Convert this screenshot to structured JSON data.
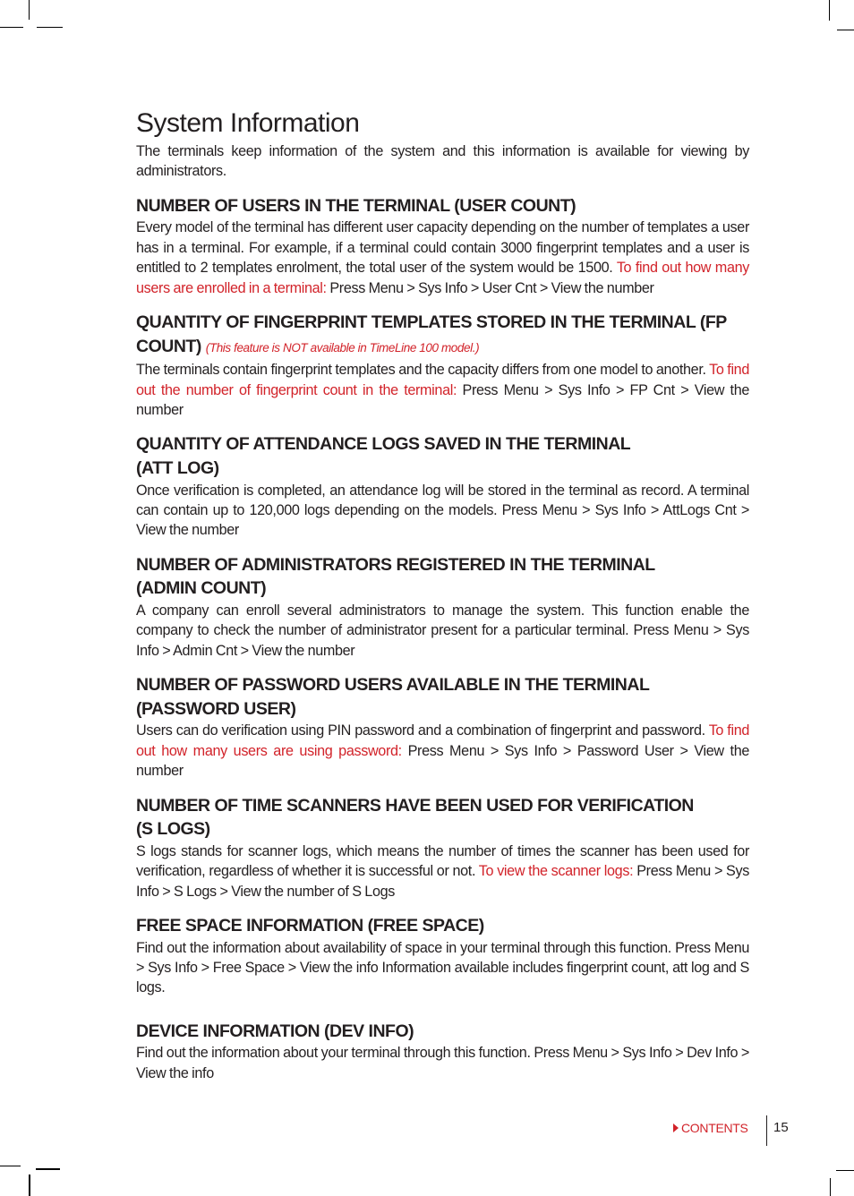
{
  "page": {
    "title": "System Information",
    "intro": "The terminals keep information of the system and this information is available for viewing by administrators."
  },
  "sections": [
    {
      "heading": "NUMBER OF USERS IN THE TERMINAL (USER COUNT)",
      "body_before": "Every model of the terminal has different user capacity depending on the number of templates a user has in a terminal. For example, if a terminal could contain 3000 fingerprint templates and a user is entitled to 2 templates enrolment, the total user of the system would be 1500. ",
      "highlight": "To find out how many users are enrolled in a terminal:",
      "body_after": " Press Menu > Sys Info > User Cnt > View the number"
    },
    {
      "heading": "QUANTITY OF FINGERPRINT TEMPLATES STORED IN THE TERMINAL (FP COUNT)",
      "note": "(This feature is NOT available in TimeLine 100 model.)",
      "body_before": "The terminals contain fingerprint templates and the capacity differs from one model to another. ",
      "highlight": "To find out the number of fingerprint count in the terminal:",
      "body_after": " Press Menu > Sys Info > FP Cnt > View the number"
    },
    {
      "heading_line1": "QUANTITY OF ATTENDANCE LOGS SAVED IN THE TERMINAL",
      "heading_line2": "(ATT LOG)",
      "body": "Once verification is completed, an attendance log will be stored in the terminal as record. A terminal can contain up to 120,000 logs depending on the models. Press Menu > Sys Info > AttLogs Cnt > View the number"
    },
    {
      "heading_line1": "NUMBER OF ADMINISTRATORS REGISTERED IN THE TERMINAL",
      "heading_line2": "(ADMIN COUNT)",
      "body": "A company can enroll several administrators to manage the system. This function enable the company to check the number of administrator present for a particular terminal. Press Menu > Sys Info > Admin Cnt > View the number"
    },
    {
      "heading_line1": "NUMBER OF PASSWORD USERS AVAILABLE IN THE TERMINAL",
      "heading_line2": "(PASSWORD USER)",
      "body_before": "Users can do verification using PIN password and a combination of fingerprint and password. ",
      "highlight": "To find out how many users are using password:",
      "body_after": " Press Menu > Sys Info > Password User > View the number"
    },
    {
      "heading_line1": "NUMBER OF TIME SCANNERS HAVE BEEN USED FOR VERIFICATION",
      "heading_line2": "(S LOGS)",
      "body_before": "S logs stands for scanner logs, which means the number of times the scanner has been used for verification, regardless of whether it is successful or not. ",
      "highlight": "To view the scanner logs:",
      "body_after": " Press Menu > Sys Info > S Logs > View the number of S Logs"
    },
    {
      "heading": "FREE SPACE INFORMATION (FREE SPACE)",
      "body": "Find out the information about availability of space in your terminal through this function. Press Menu > Sys Info > Free Space > View the info Information available includes fingerprint count, att log and S logs."
    },
    {
      "heading": "DEVICE INFORMATION (DEV INFO)",
      "body": "Find out the information about your terminal through this function. Press Menu > Sys Info > Dev Info > View the info"
    }
  ],
  "footer": {
    "contents_label": "CONTENTS",
    "contents_icon": "triangle-right-icon",
    "page_number": "15"
  },
  "colors": {
    "accent": "#d2232a",
    "text": "#231f20"
  }
}
